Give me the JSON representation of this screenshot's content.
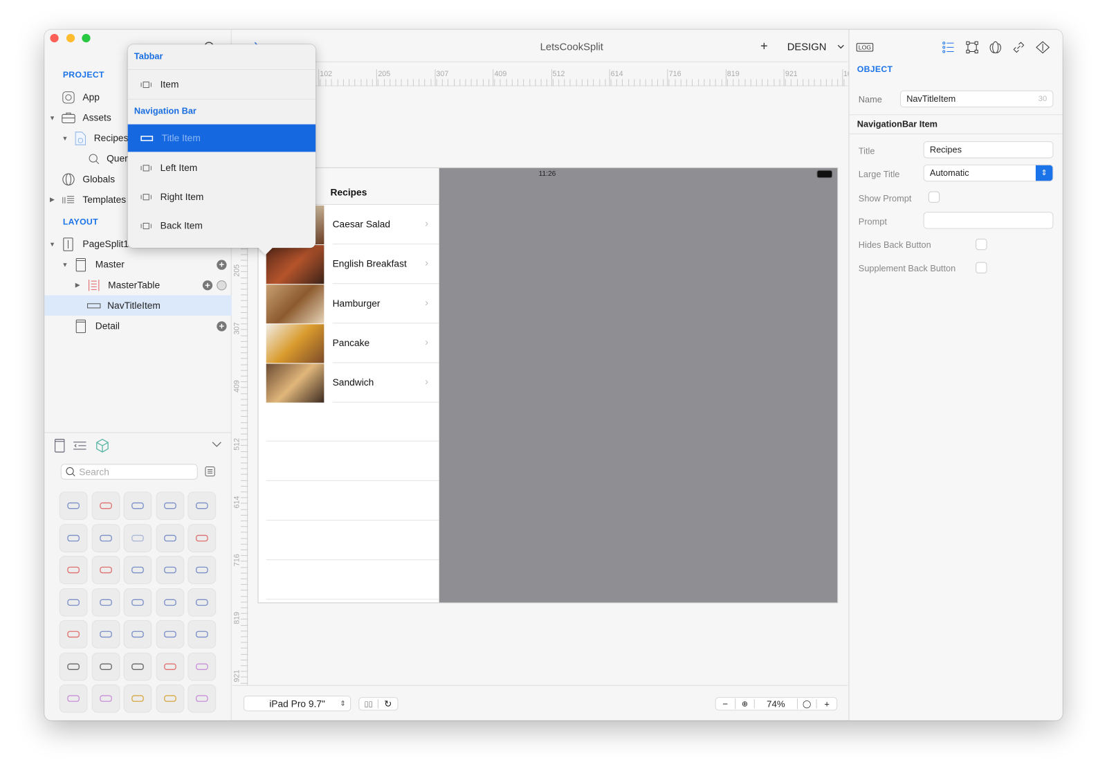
{
  "window": {
    "title": "LetsCookSplit",
    "mode": "DESIGN",
    "add_label": "+"
  },
  "sidebar": {
    "project_label": "PROJECT",
    "project_items": [
      {
        "label": "App",
        "icon": "app-icon"
      },
      {
        "label": "Assets",
        "icon": "briefcase-icon"
      },
      {
        "label": "Recipes",
        "icon": "database-doc-icon"
      },
      {
        "label": "Query",
        "icon": "search-icon"
      },
      {
        "label": "Globals",
        "icon": "globe-icon"
      },
      {
        "label": "Templates",
        "icon": "templates-icon"
      }
    ],
    "layout_label": "LAYOUT",
    "layout_items": [
      {
        "label": "PageSplit1"
      },
      {
        "label": "Master"
      },
      {
        "label": "MasterTable"
      },
      {
        "label": "NavTitleItem",
        "selected": true
      },
      {
        "label": "Detail"
      }
    ],
    "search_placeholder": "Search"
  },
  "popover": {
    "sections": [
      {
        "header": "Tabbar",
        "items": [
          {
            "label": "Item"
          }
        ]
      },
      {
        "header": "Navigation Bar",
        "items": [
          {
            "label": "Title Item",
            "selected": true
          },
          {
            "label": "Left Item"
          },
          {
            "label": "Right Item"
          },
          {
            "label": "Back Item"
          }
        ]
      }
    ]
  },
  "ruler": {
    "h": [
      "102",
      "205",
      "307",
      "409",
      "512",
      "614",
      "716",
      "819",
      "921",
      "10"
    ],
    "v": [
      "205",
      "307",
      "409",
      "512",
      "614",
      "716",
      "819",
      "921"
    ]
  },
  "device": {
    "time": "11:26",
    "nav_title": "Recipes",
    "rows": [
      "Caesar Salad",
      "English Breakfast",
      "Hamburger",
      "Pancake",
      "Sandwich"
    ]
  },
  "bottom": {
    "device_name": "iPad Pro 9.7\"",
    "zoom": "74%",
    "minus": "−",
    "plus": "+"
  },
  "inspector": {
    "log_label": "LOG",
    "object_label": "OBJECT",
    "name_label": "Name",
    "name_value": "NavTitleItem",
    "name_count": "30",
    "section_title": "NavigationBar Item",
    "title_label": "Title",
    "title_value": "Recipes",
    "large_title_label": "Large Title",
    "large_title_value": "Automatic",
    "show_prompt_label": "Show Prompt",
    "show_prompt": false,
    "prompt_label": "Prompt",
    "prompt_value": "",
    "hides_back_label": "Hides Back Button",
    "hides_back": false,
    "supplement_back_label": "Supplement Back Button",
    "supplement_back": false
  },
  "colors": {
    "accent": "#1a73e8",
    "selection": "#1668e0",
    "detail_bg": "#8e8e93"
  }
}
